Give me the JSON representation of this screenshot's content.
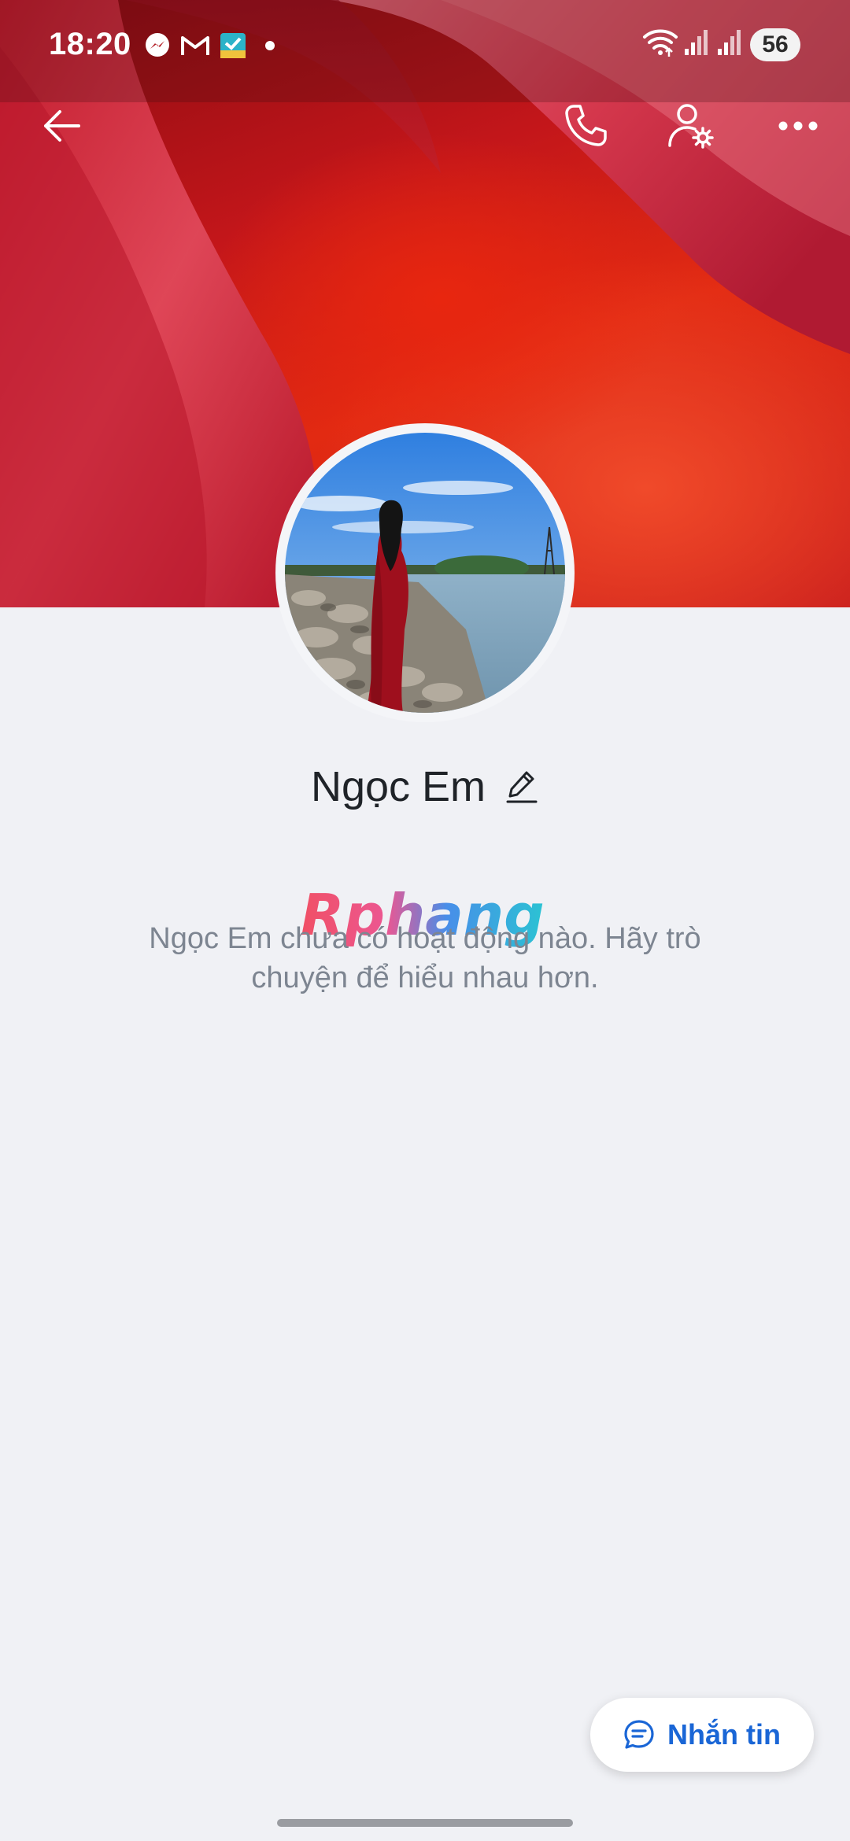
{
  "status_bar": {
    "time": "18:20",
    "notification_icons": [
      "messenger-icon",
      "gmail-icon",
      "app-check-icon"
    ],
    "battery": "56"
  },
  "toolbar": {
    "back_icon": "arrow-left-icon",
    "call_icon": "phone-icon",
    "settings_icon": "user-settings-icon",
    "more_icon": "more-horizontal-icon"
  },
  "profile": {
    "name": "Ngọc Em",
    "empty_message": "Ngọc Em chưa có hoạt động nào. Hãy trò chuyện để hiểu nhau hơn."
  },
  "watermark": "Rphang",
  "message_button": {
    "label": "Nhắn tin",
    "icon": "chat-bubble-icon"
  },
  "colors": {
    "accent": "#1a66d6",
    "background": "#f0f1f5",
    "cover_red": "#d0201a"
  }
}
